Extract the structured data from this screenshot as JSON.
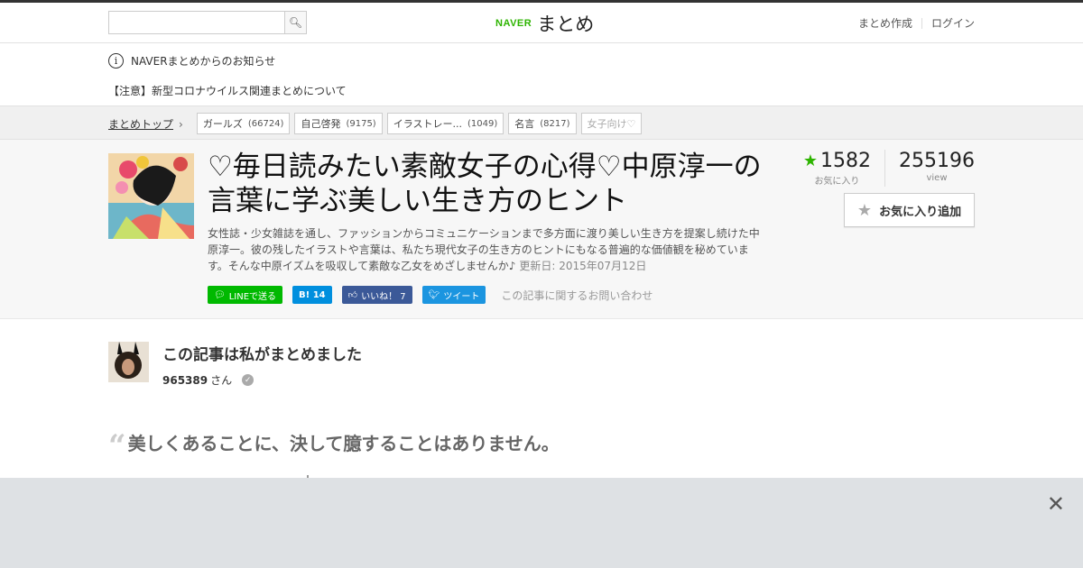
{
  "header": {
    "search": {
      "value": "",
      "placeholder": ""
    },
    "logo": {
      "brand": "NAVER",
      "name": "まとめ"
    },
    "nav": [
      "まとめ作成",
      "ログイン"
    ]
  },
  "notice": {
    "title": "NAVERまとめからのお知らせ",
    "item": "【注意】新型コロナウイルス関連まとめについて"
  },
  "breadcrumb": {
    "top": "まとめトップ",
    "tags": [
      {
        "label": "ガールズ",
        "count": "(66724)"
      },
      {
        "label": "自己啓発",
        "count": "(9175)"
      },
      {
        "label": "イラストレー...",
        "count": "(1049)"
      },
      {
        "label": "名言",
        "count": "(8217)"
      },
      {
        "label": "女子向け♡",
        "count": ""
      }
    ]
  },
  "article": {
    "title": "♡毎日読みたい素敵女子の心得♡中原淳一の言葉に学ぶ美しい生き方のヒント",
    "description": "女性誌・少女雑誌を通し、ファッションからコミュニケーションまで多方面に渡り美しい生き方を提案し続けた中原淳一。彼の残したイラストや言葉は、私たち現代女子の生き方のヒントにもなる普遍的な価値観を秘めています。そんな中原イズムを吸収して素敵な乙女をめざしませんか♪",
    "updated": "更新日: 2015年07月12日",
    "share": {
      "line": "LINEで送る",
      "hatena": "B! 14",
      "facebook": "いいね！ 7",
      "twitter": "ツイート",
      "contact": "この記事に関するお問い合わせ"
    },
    "favorites": {
      "count": "1582",
      "label": "お気に入り"
    },
    "views": {
      "count": "255196",
      "label": "view"
    },
    "fav_button": "お気に入り追加"
  },
  "author": {
    "heading": "この記事は私がまとめました",
    "name": "965389",
    "suffix": "さん"
  },
  "quote": "美しくあることに、決して臆することはありません。",
  "colors": {
    "brand_green": "#2db400",
    "line_green": "#00b900",
    "facebook": "#3b5998",
    "twitter": "#1b95e0",
    "hatena": "#008fde"
  }
}
